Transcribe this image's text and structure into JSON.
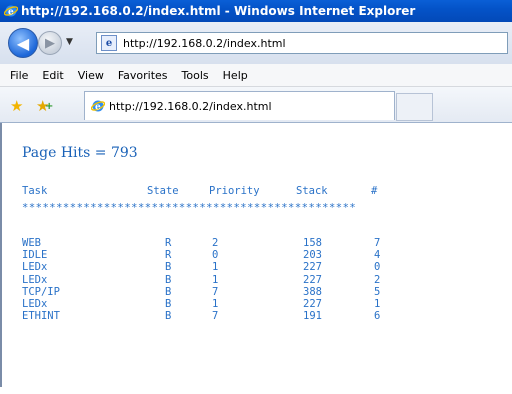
{
  "window": {
    "title": "http://192.168.0.2/index.html - Windows Internet Explorer"
  },
  "address_bar": {
    "url": "http://192.168.0.2/index.html"
  },
  "menu": {
    "items": [
      "File",
      "Edit",
      "View",
      "Favorites",
      "Tools",
      "Help"
    ]
  },
  "favorites_bar": {
    "tab_title": "http://192.168.0.2/index.html"
  },
  "page": {
    "hits": "Page Hits = 793",
    "header": {
      "task": "Task",
      "state": "State",
      "priority": "Priority",
      "stack": "Stack",
      "num": "#"
    },
    "separator": "*************************************************",
    "rows": [
      {
        "task": "WEB",
        "state": "R",
        "priority": "2",
        "stack": "158",
        "num": "7"
      },
      {
        "task": "IDLE",
        "state": "R",
        "priority": "0",
        "stack": "203",
        "num": "4"
      },
      {
        "task": "LEDx",
        "state": "B",
        "priority": "1",
        "stack": "227",
        "num": "0"
      },
      {
        "task": "LEDx",
        "state": "B",
        "priority": "1",
        "stack": "227",
        "num": "2"
      },
      {
        "task": "TCP/IP",
        "state": "B",
        "priority": "7",
        "stack": "388",
        "num": "5"
      },
      {
        "task": "LEDx",
        "state": "B",
        "priority": "1",
        "stack": "227",
        "num": "1"
      },
      {
        "task": "ETHINT",
        "state": "B",
        "priority": "7",
        "stack": "191",
        "num": "6"
      }
    ]
  },
  "icons": {
    "browser": "ie-icon",
    "back": "back-arrow-icon",
    "forward": "forward-arrow-icon",
    "favorites": "favorites-star-icon",
    "add_favorites": "add-favorites-icon"
  }
}
